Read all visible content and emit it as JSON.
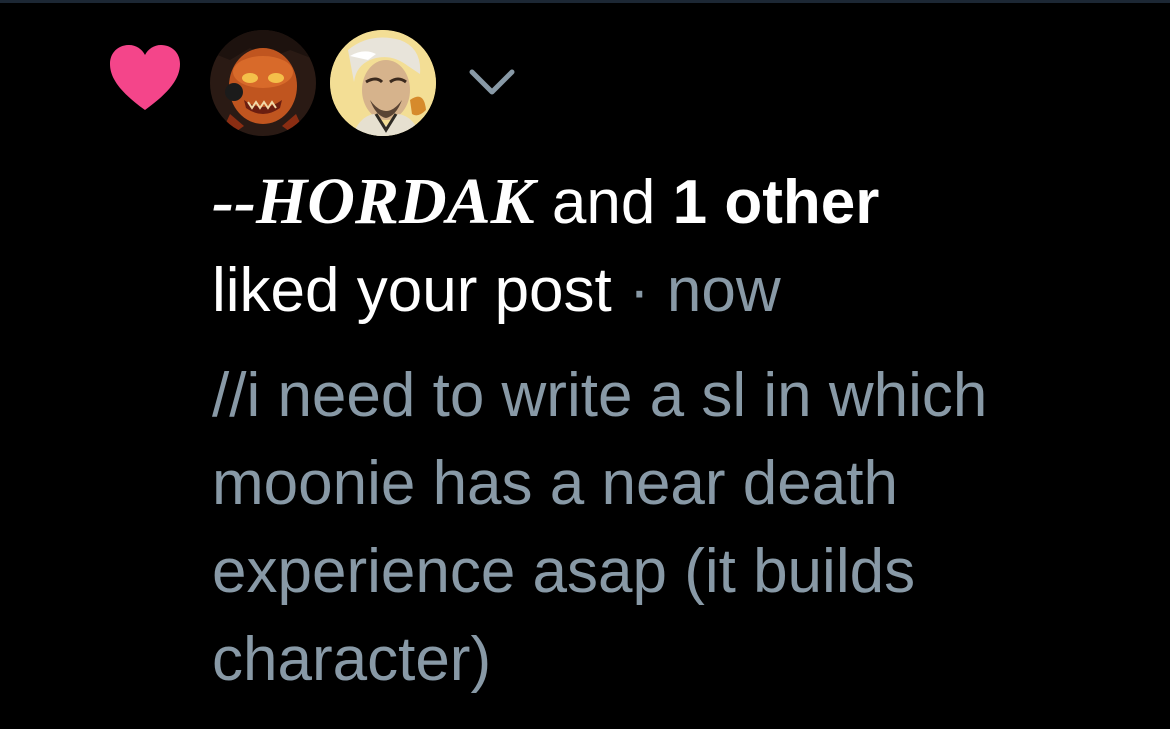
{
  "notification": {
    "icon": "heart-icon",
    "heart_color": "#f4458a",
    "avatars": [
      {
        "name": "avatar-hordak",
        "icon": "avatar-icon"
      },
      {
        "name": "avatar-other",
        "icon": "avatar-icon"
      }
    ],
    "expand_icon": "chevron-down-icon",
    "username": "--HORDAK",
    "and_text": "and",
    "others_count": "1 other",
    "action": "liked your post",
    "separator": "·",
    "time": "now",
    "post_preview_lines": [
      "//i need to write a sl in which",
      "moonie has a near death",
      "experience asap (it builds",
      "character)"
    ]
  },
  "colors": {
    "background": "#000000",
    "primary_text": "#ffffff",
    "secondary_text": "#8899a6",
    "heart": "#f4458a"
  }
}
